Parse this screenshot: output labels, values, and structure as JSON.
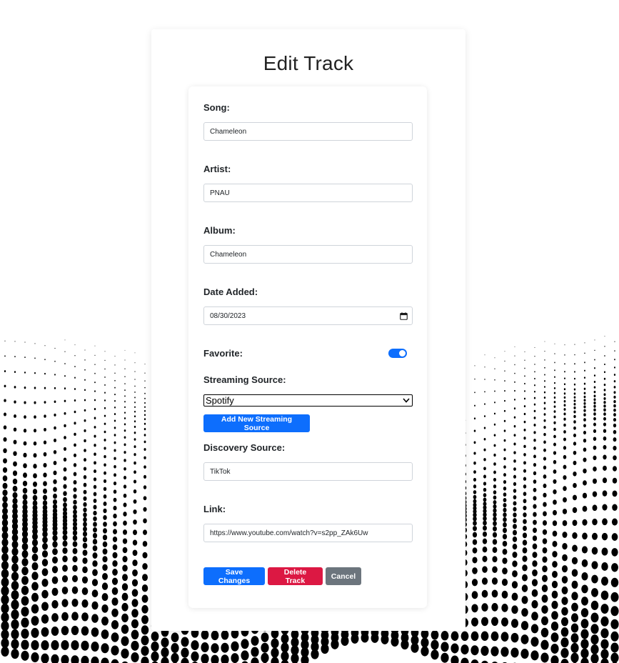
{
  "page": {
    "title": "Edit Track"
  },
  "form": {
    "song": {
      "label": "Song:",
      "value": "Chameleon"
    },
    "artist": {
      "label": "Artist:",
      "value": "PNAU"
    },
    "album": {
      "label": "Album:",
      "value": "Chameleon"
    },
    "date_added": {
      "label": "Date Added:",
      "value": "08/30/2023"
    },
    "favorite": {
      "label": "Favorite:",
      "checked": true
    },
    "streaming_source": {
      "label": "Streaming Source:",
      "selected": "Spotify",
      "add_button_label": "Add New Streaming Source"
    },
    "discovery_source": {
      "label": "Discovery Source:",
      "value": "TikTok"
    },
    "link": {
      "label": "Link:",
      "value": "https://www.youtube.com/watch?v=s2pp_ZAk6Uw"
    }
  },
  "actions": {
    "save_label": "Save Changes",
    "delete_label": "Delete Track",
    "cancel_label": "Cancel"
  },
  "icons": {
    "calendar": "calendar-icon",
    "select_arrow": "chevron-down-icon"
  },
  "colors": {
    "primary": "#0d6efd",
    "danger": "#dc1843",
    "secondary": "#6c757d"
  }
}
